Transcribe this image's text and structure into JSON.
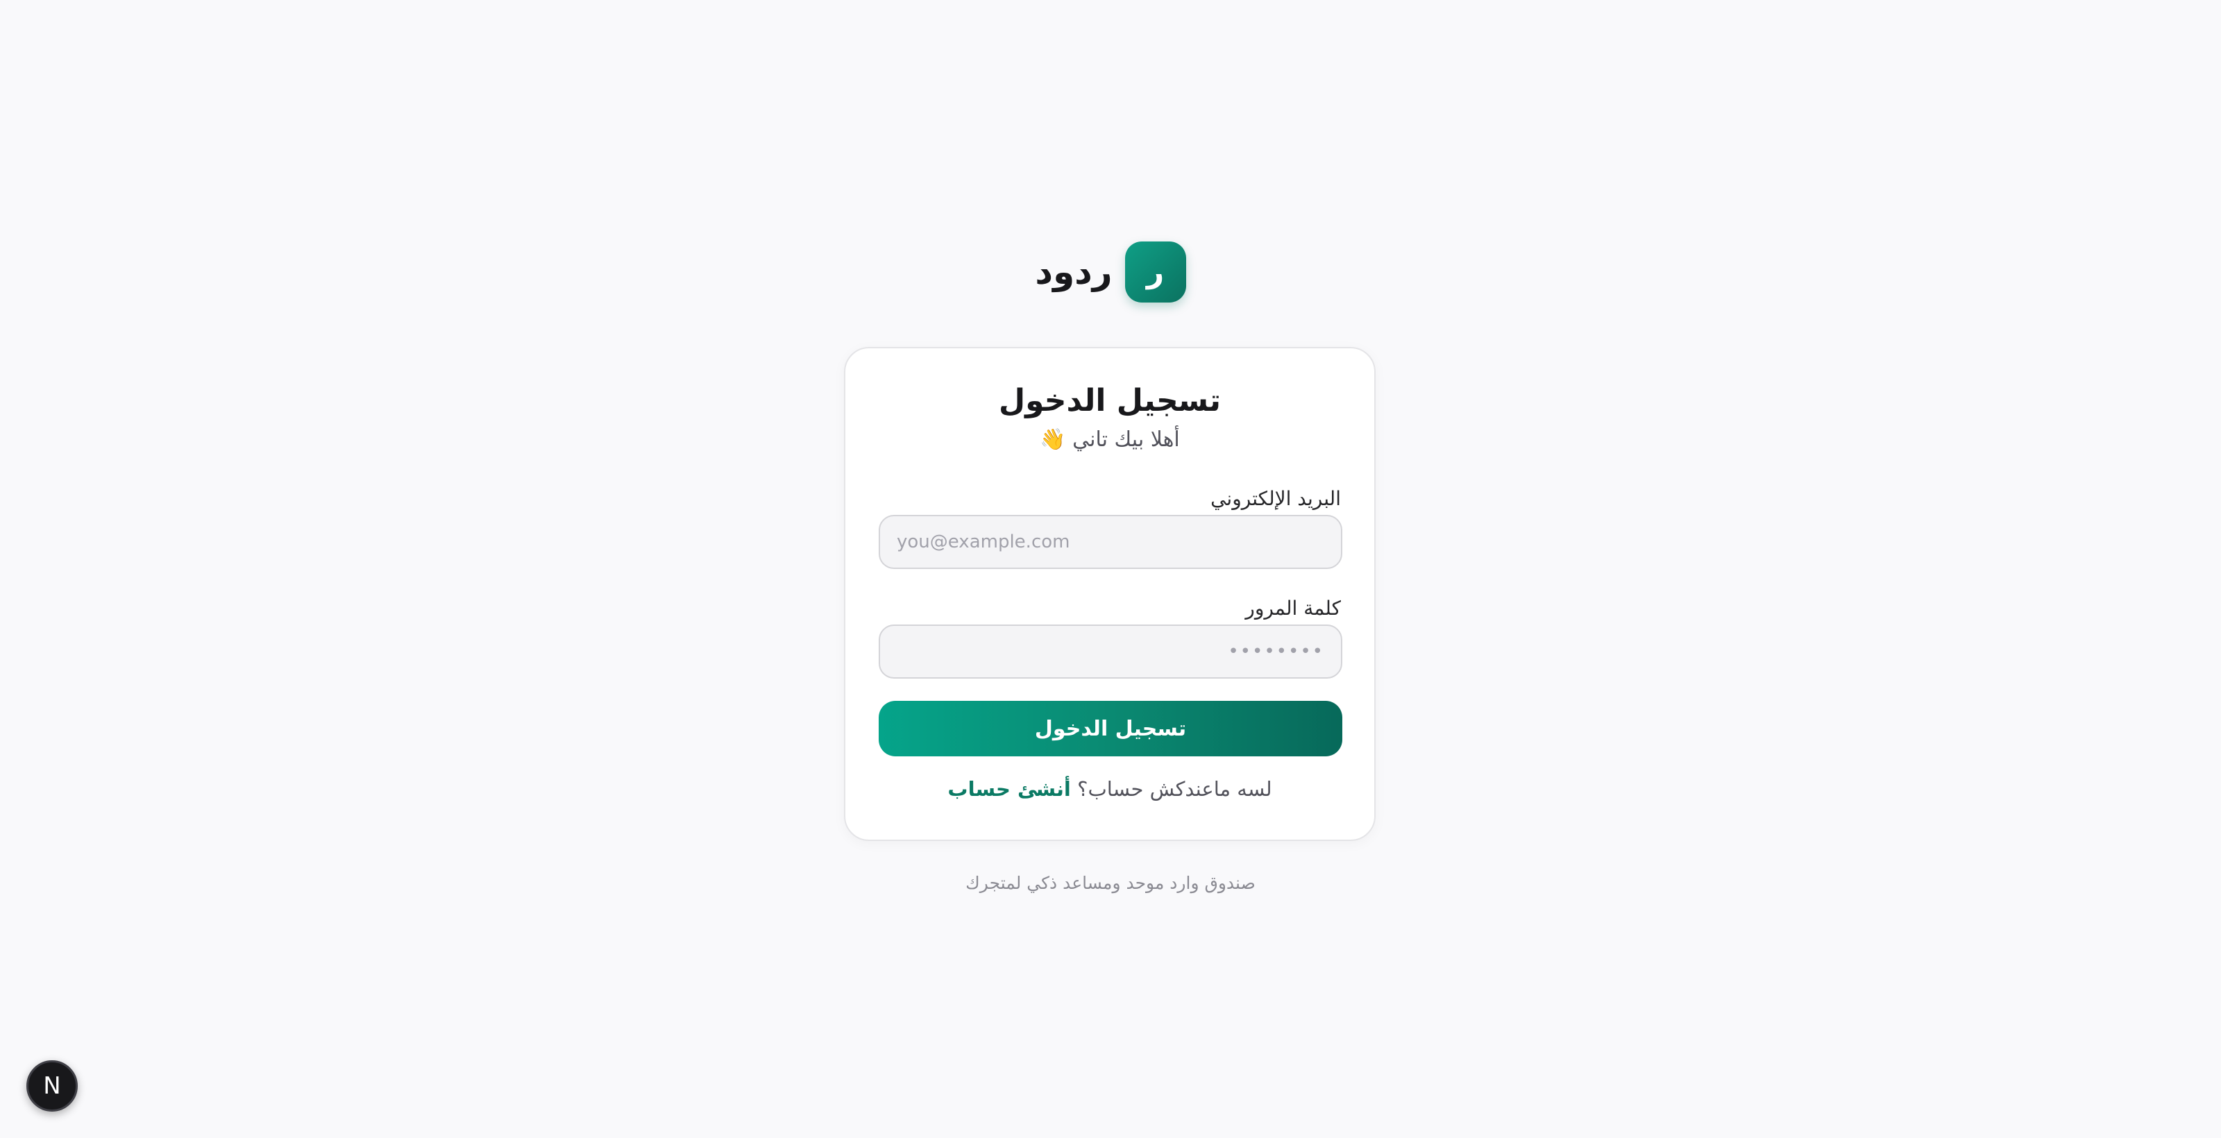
{
  "brand": {
    "logo_letter": "ر",
    "name": "ردود",
    "accent_color": "#0b7a64"
  },
  "login_card": {
    "title": "تسجيل الدخول",
    "subtitle": "أهلا بيك تاني 👋",
    "email": {
      "label": "البريد الإلكتروني",
      "value": "",
      "placeholder": "you@example.com"
    },
    "password": {
      "label": "كلمة المرور",
      "value": "",
      "placeholder": "••••••••"
    },
    "submit_label": "تسجيل الدخول",
    "signup_prompt": "لسه ماعندكش حساب؟",
    "signup_link": "أنشئ حساب"
  },
  "footer": {
    "tagline": "صندوق وارد موحد ومساعد ذكي لمتجرك"
  },
  "dev_badge": {
    "icon": "nextjs-logo-icon",
    "letter": "N"
  }
}
